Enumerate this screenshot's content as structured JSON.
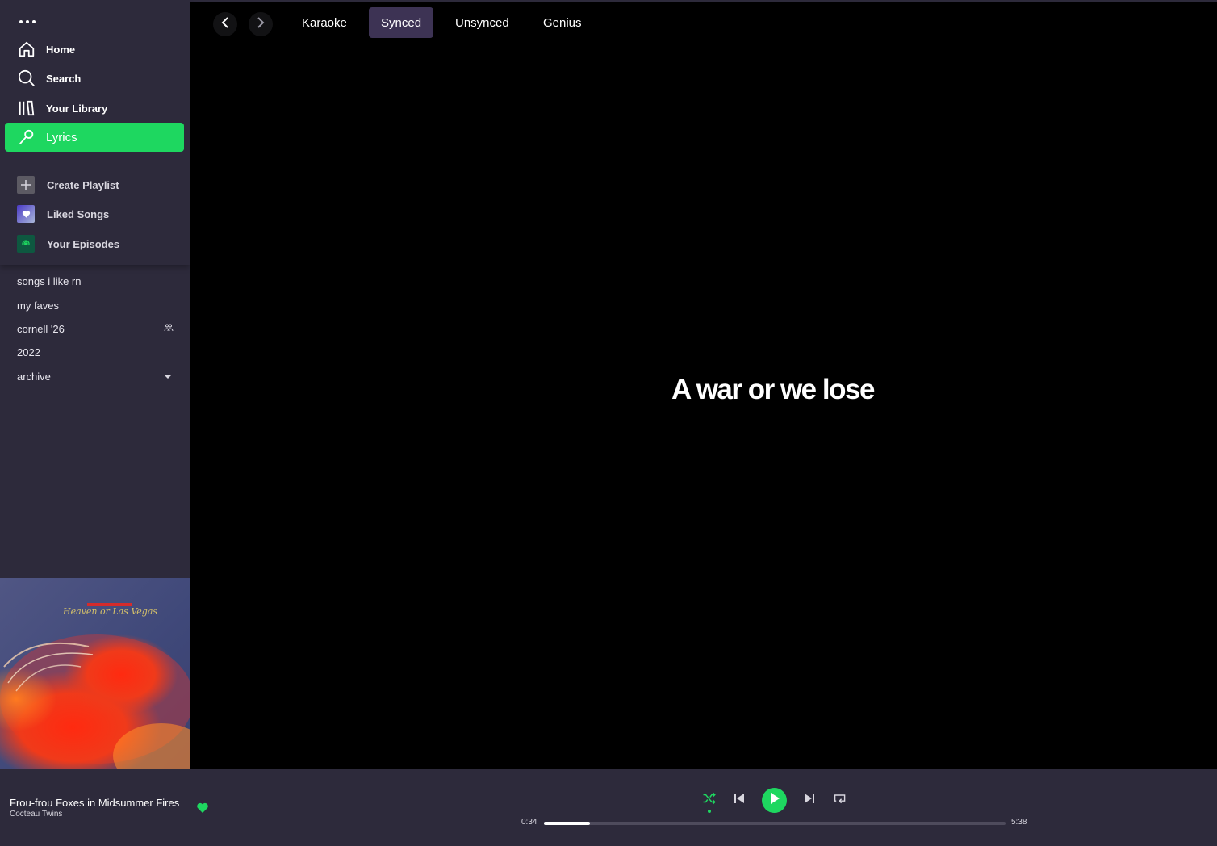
{
  "sidebar": {
    "nav": [
      {
        "label": "Home",
        "icon": "home-icon"
      },
      {
        "label": "Search",
        "icon": "search-icon"
      },
      {
        "label": "Your Library",
        "icon": "library-icon"
      },
      {
        "label": "Lyrics",
        "icon": "microphone-icon"
      }
    ],
    "library": [
      {
        "label": "Create Playlist",
        "icon": "plus-icon"
      },
      {
        "label": "Liked Songs",
        "icon": "heart-icon"
      },
      {
        "label": "Your Episodes",
        "icon": "podcast-icon"
      }
    ],
    "playlists": [
      {
        "label": "songs i like rn"
      },
      {
        "label": "my faves"
      },
      {
        "label": "cornell '26",
        "badge_icon": "collaborative-icon"
      },
      {
        "label": "2022"
      },
      {
        "label": "archive",
        "badge_icon": "caret-down-icon"
      }
    ],
    "cover_art": {
      "text": "Heaven or Las Vegas"
    }
  },
  "topbar": {
    "tabs": [
      {
        "label": "Karaoke",
        "active": false
      },
      {
        "label": "Synced",
        "active": true
      },
      {
        "label": "Unsynced",
        "active": false
      },
      {
        "label": "Genius",
        "active": false
      }
    ]
  },
  "lyrics": {
    "current_line": "A war or we lose"
  },
  "player": {
    "title": "Frou-frou Foxes in Midsummer Fires",
    "artist": "Cocteau Twins",
    "liked": true,
    "elapsed": "0:34",
    "duration": "5:38",
    "progress_fraction": 0.1
  },
  "colors": {
    "accent": "#1ed760",
    "sidebar_bg": "#2d2a3b",
    "active_tab_bg": "#3d3354",
    "main_bg": "#000000"
  }
}
